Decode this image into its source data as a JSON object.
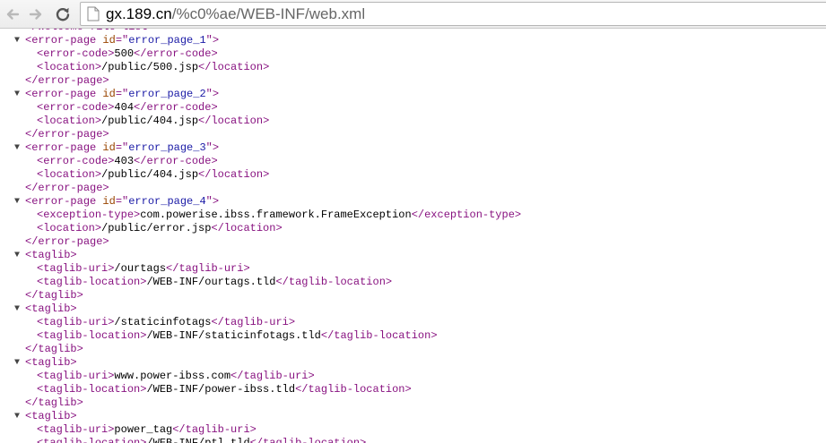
{
  "browser": {
    "url_host": "gx.189.cn",
    "url_path": "/%c0%ae/WEB-INF/web.xml"
  },
  "xml": {
    "lines": [
      {
        "type": "close",
        "indent": 0,
        "tag": "welcome-file-list"
      },
      {
        "type": "open",
        "indent": 0,
        "tag": "error-page",
        "attr": "id",
        "value": "error_page_1",
        "toggle": "▼"
      },
      {
        "type": "elem",
        "indent": 1,
        "tag": "error-code",
        "text": "500"
      },
      {
        "type": "elem",
        "indent": 1,
        "tag": "location",
        "text": "/public/500.jsp"
      },
      {
        "type": "close",
        "indent": 0,
        "tag": "error-page"
      },
      {
        "type": "open",
        "indent": 0,
        "tag": "error-page",
        "attr": "id",
        "value": "error_page_2",
        "toggle": "▼"
      },
      {
        "type": "elem",
        "indent": 1,
        "tag": "error-code",
        "text": "404"
      },
      {
        "type": "elem",
        "indent": 1,
        "tag": "location",
        "text": "/public/404.jsp"
      },
      {
        "type": "close",
        "indent": 0,
        "tag": "error-page"
      },
      {
        "type": "open",
        "indent": 0,
        "tag": "error-page",
        "attr": "id",
        "value": "error_page_3",
        "toggle": "▼"
      },
      {
        "type": "elem",
        "indent": 1,
        "tag": "error-code",
        "text": "403"
      },
      {
        "type": "elem",
        "indent": 1,
        "tag": "location",
        "text": "/public/404.jsp"
      },
      {
        "type": "close",
        "indent": 0,
        "tag": "error-page"
      },
      {
        "type": "open",
        "indent": 0,
        "tag": "error-page",
        "attr": "id",
        "value": "error_page_4",
        "toggle": "▼"
      },
      {
        "type": "elem",
        "indent": 1,
        "tag": "exception-type",
        "text": "com.powerise.ibss.framework.FrameException"
      },
      {
        "type": "elem",
        "indent": 1,
        "tag": "location",
        "text": "/public/error.jsp"
      },
      {
        "type": "close",
        "indent": 0,
        "tag": "error-page"
      },
      {
        "type": "open",
        "indent": 0,
        "tag": "taglib",
        "toggle": "▼"
      },
      {
        "type": "elem",
        "indent": 1,
        "tag": "taglib-uri",
        "text": "/ourtags"
      },
      {
        "type": "elem",
        "indent": 1,
        "tag": "taglib-location",
        "text": "/WEB-INF/ourtags.tld"
      },
      {
        "type": "close",
        "indent": 0,
        "tag": "taglib"
      },
      {
        "type": "open",
        "indent": 0,
        "tag": "taglib",
        "toggle": "▼"
      },
      {
        "type": "elem",
        "indent": 1,
        "tag": "taglib-uri",
        "text": "/staticinfotags"
      },
      {
        "type": "elem",
        "indent": 1,
        "tag": "taglib-location",
        "text": "/WEB-INF/staticinfotags.tld"
      },
      {
        "type": "close",
        "indent": 0,
        "tag": "taglib"
      },
      {
        "type": "open",
        "indent": 0,
        "tag": "taglib",
        "toggle": "▼"
      },
      {
        "type": "elem",
        "indent": 1,
        "tag": "taglib-uri",
        "text": "www.power-ibss.com"
      },
      {
        "type": "elem",
        "indent": 1,
        "tag": "taglib-location",
        "text": "/WEB-INF/power-ibss.tld"
      },
      {
        "type": "close",
        "indent": 0,
        "tag": "taglib"
      },
      {
        "type": "open",
        "indent": 0,
        "tag": "taglib",
        "toggle": "▼"
      },
      {
        "type": "elem",
        "indent": 1,
        "tag": "taglib-uri",
        "text": "power_tag"
      },
      {
        "type": "elem",
        "indent": 1,
        "tag": "taglib-location",
        "text": "/WEB-INF/ptl.tld"
      }
    ]
  }
}
